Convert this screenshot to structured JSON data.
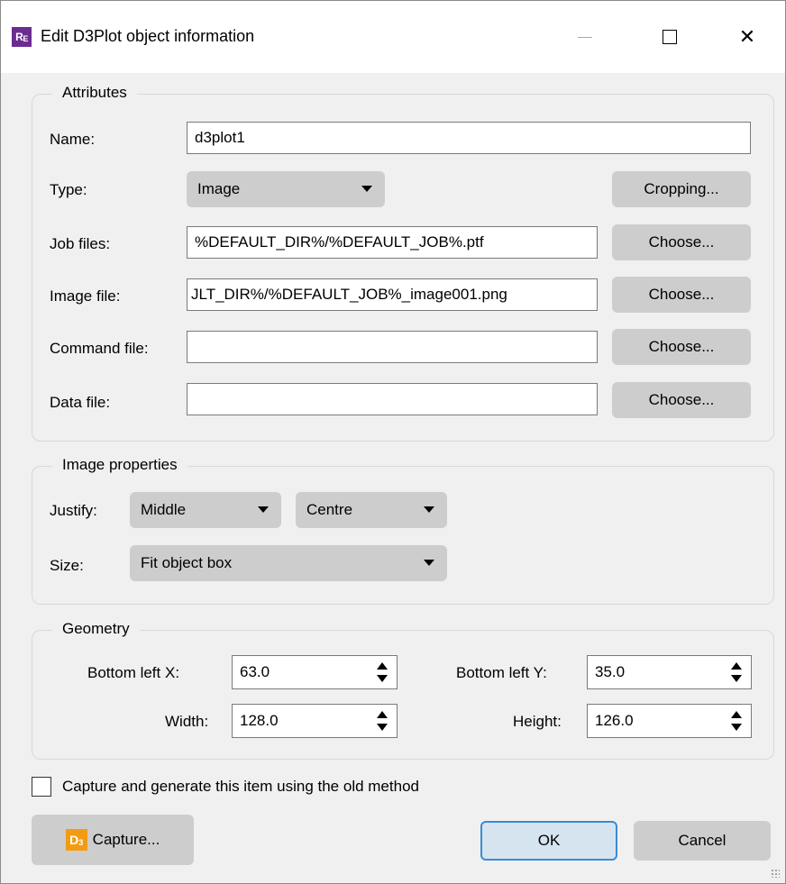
{
  "window": {
    "title": "Edit D3Plot object information",
    "icon_text": "R",
    "icon_sub": "E",
    "controls": [
      "minimize-icon",
      "maximize-icon",
      "close-icon"
    ],
    "close_glyph": "✕"
  },
  "attributes": {
    "group_title": "Attributes",
    "name_label": "Name:",
    "name_value": "d3plot1",
    "type_label": "Type:",
    "type_value": "Image",
    "cropping_button": "Cropping...",
    "job_files_label": "Job files:",
    "job_files_value": "%DEFAULT_DIR%/%DEFAULT_JOB%.ptf",
    "image_file_label": "Image file:",
    "image_file_value": "JLT_DIR%/%DEFAULT_JOB%_image001.png",
    "command_file_label": "Command file:",
    "command_file_value": "",
    "data_file_label": "Data file:",
    "data_file_value": "",
    "choose_button": "Choose..."
  },
  "image_properties": {
    "group_title": "Image properties",
    "justify_label": "Justify:",
    "justify_vertical": "Middle",
    "justify_horizontal": "Centre",
    "size_label": "Size:",
    "size_value": "Fit object box"
  },
  "geometry": {
    "group_title": "Geometry",
    "bottom_left_x_label": "Bottom left X:",
    "bottom_left_x_value": "63.0",
    "bottom_left_y_label": "Bottom left Y:",
    "bottom_left_y_value": "35.0",
    "width_label": "Width:",
    "width_value": "128.0",
    "height_label": "Height:",
    "height_value": "126.0"
  },
  "footer": {
    "old_method_label": "Capture and generate this item using the old method",
    "old_method_checked": false,
    "capture_button": "Capture...",
    "capture_icon_text": "D",
    "capture_icon_sub": "3",
    "ok_button": "OK",
    "cancel_button": "Cancel"
  },
  "colors": {
    "app_icon": "#6b2c91",
    "capture_icon": "#f39c12",
    "ok_border": "#3a8bd6",
    "button_bg": "#cdcdcd"
  }
}
